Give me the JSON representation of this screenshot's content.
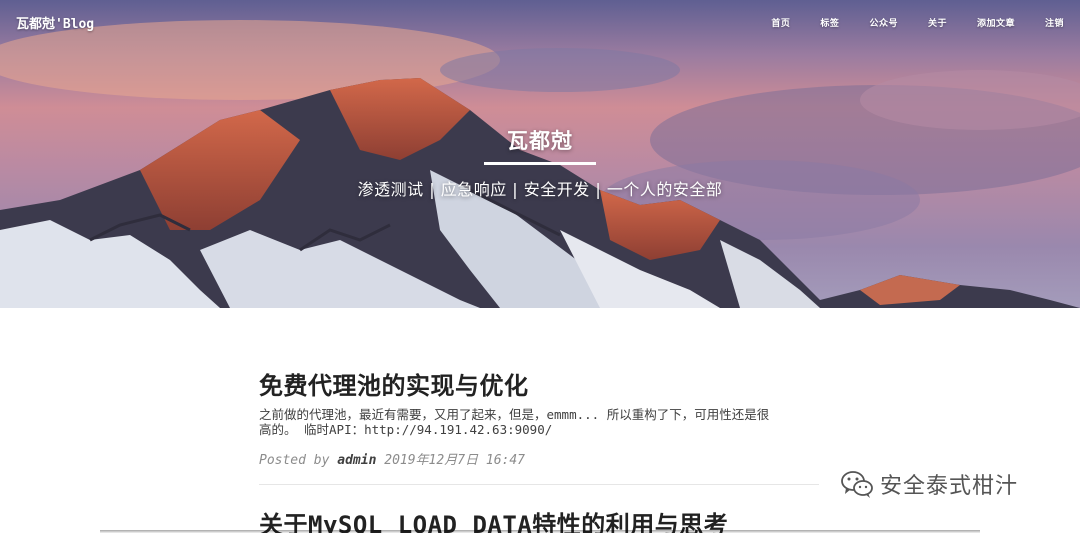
{
  "header": {
    "brand": "瓦都尅'Blog",
    "nav": [
      "首页",
      "标签",
      "公众号",
      "关于",
      "添加文章",
      "注销"
    ]
  },
  "hero": {
    "title": "瓦都尅",
    "subtitle": "渗透测试  |  应急响应  |  安全开发  |  一个人的安全部",
    "background": "snowy mountain peak at sunset"
  },
  "posts": [
    {
      "title": "免费代理池的实现与优化",
      "excerpt_line1": "之前做的代理池，最近有需要，又用了起来，但是，emmm... 所以重构了下，可用性还是很",
      "excerpt_line2": "高的。 临时API：http://94.191.42.63:9090/",
      "meta_prefix": "Posted by ",
      "author": "admin",
      "date": " 2019年12月7日 16:47"
    },
    {
      "title": "关于MySQL LOAD DATA特性的利用与思考"
    }
  ],
  "watermark": {
    "text": "安全泰式柑汁",
    "icon": "wechat-icon"
  },
  "colors": {
    "text_dark": "#222222",
    "text_meta": "#8c8c8c",
    "hero_text": "#ffffff"
  }
}
